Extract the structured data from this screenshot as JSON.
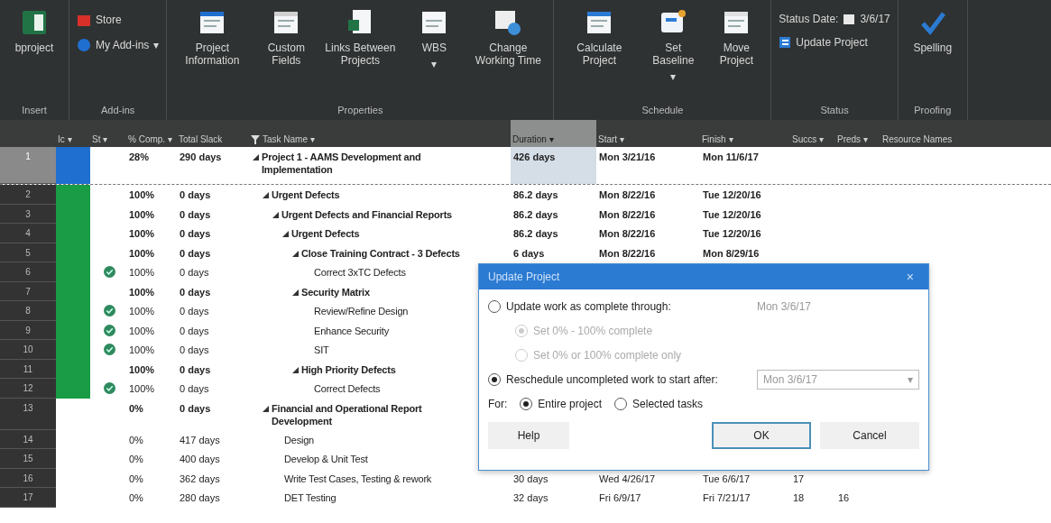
{
  "ribbon": {
    "groups": [
      {
        "label": "Insert",
        "buttons": [
          {
            "kind": "large",
            "label": "bproject"
          }
        ]
      },
      {
        "label": "Add-ins",
        "buttons": [
          {
            "kind": "small",
            "label": "Store"
          },
          {
            "kind": "small",
            "label": "My Add-ins",
            "caret": "▾"
          }
        ]
      },
      {
        "label": "Properties",
        "buttons": [
          {
            "kind": "large",
            "label": "Project Information"
          },
          {
            "kind": "large",
            "label": "Custom Fields"
          },
          {
            "kind": "large",
            "label": "Links Between Projects"
          },
          {
            "kind": "large",
            "label": "WBS",
            "caret": "▾"
          },
          {
            "kind": "large",
            "label": "Change Working Time"
          }
        ]
      },
      {
        "label": "Schedule",
        "buttons": [
          {
            "kind": "large",
            "label": "Calculate Project"
          },
          {
            "kind": "large",
            "label": "Set Baseline",
            "caret": "▾"
          },
          {
            "kind": "large",
            "label": "Move Project"
          }
        ]
      },
      {
        "label": "Status",
        "buttons": [
          {
            "kind": "status_date",
            "label": "Status Date:",
            "value": "3/6/17"
          },
          {
            "kind": "small",
            "label": "Update Project"
          }
        ]
      },
      {
        "label": "Proofing",
        "buttons": [
          {
            "kind": "large",
            "label": "Spelling"
          }
        ]
      }
    ]
  },
  "table": {
    "columns": [
      {},
      {
        "label": "Ic",
        "caret": "▾"
      },
      {
        "label": "St",
        "caret": "▾"
      },
      {
        "label": "% Comp.",
        "caret": "▾"
      },
      {
        "label": "Total Slack"
      },
      {
        "label": "Task Name",
        "filter": true,
        "caret": "▾"
      },
      {
        "label": "Duration",
        "caret": "▾",
        "selected": true
      },
      {
        "label": "Start",
        "caret": "▾"
      },
      {
        "label": "Finish",
        "caret": "▾"
      },
      {
        "label": "Succs",
        "caret": "▾"
      },
      {
        "label": "Preds",
        "caret": "▾"
      },
      {
        "label": "Resource Names"
      }
    ],
    "tasks": [
      {
        "id": "1",
        "color": "#1f6fd1",
        "selected": true,
        "done": false,
        "pct": "28%",
        "slack": "290 days",
        "name": "Project 1 - AAMS Development and Implementation",
        "duration": "426 days",
        "start": "Mon 3/21/16",
        "finish": "Mon 11/6/17",
        "children": [
          {
            "id": "2",
            "color": "#1a9b45",
            "selected": false,
            "done": false,
            "pct": "100%",
            "slack": "0 days",
            "name": "Urgent Defects",
            "duration": "86.2 days",
            "start": "Mon 8/22/16",
            "finish": "Tue 12/20/16",
            "children": [
              {
                "id": "3",
                "color": "#1a9b45",
                "selected": false,
                "done": false,
                "pct": "100%",
                "slack": "0 days",
                "name": "Urgent Defects and Financial Reports",
                "duration": "86.2 days",
                "start": "Mon 8/22/16",
                "finish": "Tue 12/20/16",
                "children": [
                  {
                    "id": "4",
                    "color": "#1a9b45",
                    "selected": false,
                    "done": false,
                    "pct": "100%",
                    "slack": "0 days",
                    "name": "Urgent Defects",
                    "duration": "86.2 days",
                    "start": "Mon 8/22/16",
                    "finish": "Tue 12/20/16",
                    "children": [
                      {
                        "id": "5",
                        "color": "#1a9b45",
                        "selected": false,
                        "done": false,
                        "pct": "100%",
                        "slack": "0 days",
                        "name": "Close Training Contract - 3 Defects",
                        "duration": "6 days",
                        "start": "Mon 8/22/16",
                        "finish": "Mon 8/29/16",
                        "children": [
                          {
                            "id": "6",
                            "color": "#1a9b45",
                            "selected": false,
                            "done": true,
                            "pct": "100%",
                            "slack": "0 days",
                            "name": "Correct 3xTC Defects"
                          }
                        ]
                      },
                      {
                        "id": "7",
                        "color": "#1a9b45",
                        "selected": false,
                        "done": false,
                        "pct": "100%",
                        "slack": "0 days",
                        "name": "Security Matrix",
                        "children": [
                          {
                            "id": "8",
                            "color": "#1a9b45",
                            "selected": false,
                            "done": true,
                            "pct": "100%",
                            "slack": "0 days",
                            "name": "Review/Refine Design"
                          },
                          {
                            "id": "9",
                            "color": "#1a9b45",
                            "selected": false,
                            "done": true,
                            "pct": "100%",
                            "slack": "0 days",
                            "name": "Enhance Security"
                          },
                          {
                            "id": "10",
                            "color": "#1a9b45",
                            "selected": false,
                            "done": true,
                            "pct": "100%",
                            "slack": "0 days",
                            "name": "SIT"
                          }
                        ]
                      },
                      {
                        "id": "11",
                        "color": "#1a9b45",
                        "selected": false,
                        "done": false,
                        "pct": "100%",
                        "slack": "0 days",
                        "name": "High Priority Defects",
                        "children": [
                          {
                            "id": "12",
                            "color": "#1a9b45",
                            "selected": false,
                            "done": true,
                            "pct": "100%",
                            "slack": "0 days",
                            "name": "Correct Defects"
                          }
                        ]
                      }
                    ]
                  }
                ]
              }
            ]
          },
          {
            "id": "13",
            "selected": false,
            "done": false,
            "pct": "0%",
            "slack": "0 days",
            "name": "Financial and Operational Report Development",
            "children": [
              {
                "id": "14",
                "selected": false,
                "done": false,
                "pct": "0%",
                "slack": "417 days",
                "name": "Design"
              },
              {
                "id": "15",
                "selected": false,
                "done": false,
                "pct": "0%",
                "slack": "400 days",
                "name": "Develop & Unit Test"
              },
              {
                "id": "16",
                "selected": false,
                "done": false,
                "pct": "0%",
                "slack": "362 days",
                "name": "Write Test Cases, Testing & rework",
                "duration": "30 days",
                "start": "Wed 4/26/17",
                "finish": "Tue 6/6/17",
                "succs": "17"
              },
              {
                "id": "17",
                "selected": false,
                "done": false,
                "pct": "0%",
                "slack": "280 days",
                "name": "DET Testing",
                "duration": "32 days",
                "start": "Fri 6/9/17",
                "finish": "Fri 7/21/17",
                "succs": "18",
                "preds": "16"
              }
            ]
          }
        ]
      }
    ]
  },
  "dialog": {
    "title": "Update Project",
    "close": "×",
    "options": [
      {
        "kind": "radio",
        "label": "Update work as complete through:",
        "selected": false,
        "date": "Mon 3/6/17"
      },
      {
        "kind": "sub",
        "label": "Set 0% - 100% complete",
        "selected": true,
        "disabled": true
      },
      {
        "kind": "sub",
        "label": "Set 0% or 100% complete only",
        "selected": false,
        "disabled": true
      },
      {
        "kind": "radio",
        "label": "Reschedule uncompleted work to start after:",
        "selected": true,
        "field": "Mon 3/6/17",
        "caret": "▾"
      }
    ],
    "for_label": "For:",
    "scope": [
      {
        "label": "Entire project",
        "selected": true
      },
      {
        "label": "Selected tasks",
        "selected": false
      }
    ],
    "buttons": [
      {
        "label": "Help",
        "focused": false
      },
      {
        "label": "OK",
        "focused": true
      },
      {
        "label": "Cancel",
        "focused": false
      }
    ]
  }
}
